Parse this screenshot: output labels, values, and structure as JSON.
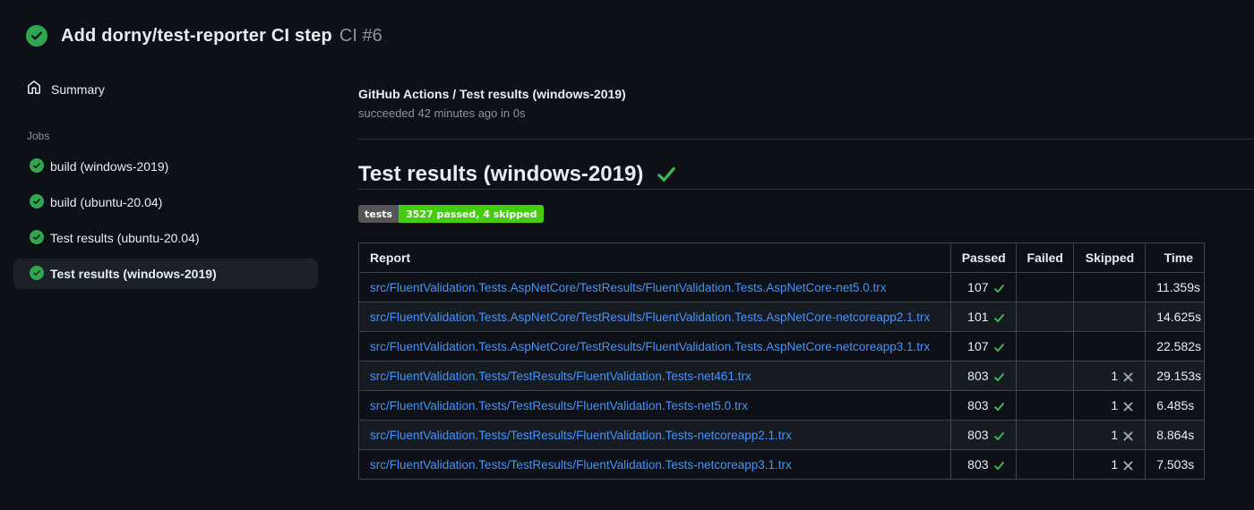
{
  "theme": {
    "page_bg": "#0d1117",
    "row_alt_bg": "#161b22",
    "selected_bg": "#1c2128",
    "border": "#3d444d",
    "link": "#4493f8",
    "success_green": "#3fb950",
    "circle_green": "#2ea84f",
    "muted_text": "#8b949e",
    "skip_gray": "#a0a8b0",
    "badge_label_bg": "#555555",
    "badge_value_bg": "#44cc11"
  },
  "header": {
    "title": "Add dorny/test-reporter CI step",
    "run_number": "CI #6",
    "status_icon": "check-circle-icon"
  },
  "sidebar": {
    "summary_label": "Summary",
    "jobs_label": "Jobs",
    "jobs": [
      {
        "label": "build (windows-2019)",
        "status": "success",
        "selected": false
      },
      {
        "label": "build (ubuntu-20.04)",
        "status": "success",
        "selected": false
      },
      {
        "label": "Test results (ubuntu-20.04)",
        "status": "success",
        "selected": false
      },
      {
        "label": "Test results (windows-2019)",
        "status": "success",
        "selected": true
      }
    ]
  },
  "main": {
    "check_title": "GitHub Actions / Test results (windows-2019)",
    "check_status": "succeeded 42 minutes ago in 0s",
    "section_title": "Test results (windows-2019)",
    "section_status_icon": "check-icon",
    "badge": {
      "label": "tests",
      "value": "3527 passed, 4 skipped"
    },
    "table": {
      "headers": [
        "Report",
        "Passed",
        "Failed",
        "Skipped",
        "Time"
      ],
      "rows": [
        {
          "report": "src/FluentValidation.Tests.AspNetCore/TestResults/FluentValidation.Tests.AspNetCore-net5.0.trx",
          "passed": "107",
          "failed": "",
          "skipped": "",
          "time": "11.359s"
        },
        {
          "report": "src/FluentValidation.Tests.AspNetCore/TestResults/FluentValidation.Tests.AspNetCore-netcoreapp2.1.trx",
          "passed": "101",
          "failed": "",
          "skipped": "",
          "time": "14.625s"
        },
        {
          "report": "src/FluentValidation.Tests.AspNetCore/TestResults/FluentValidation.Tests.AspNetCore-netcoreapp3.1.trx",
          "passed": "107",
          "failed": "",
          "skipped": "",
          "time": "22.582s"
        },
        {
          "report": "src/FluentValidation.Tests/TestResults/FluentValidation.Tests-net461.trx",
          "passed": "803",
          "failed": "",
          "skipped": "1",
          "time": "29.153s"
        },
        {
          "report": "src/FluentValidation.Tests/TestResults/FluentValidation.Tests-net5.0.trx",
          "passed": "803",
          "failed": "",
          "skipped": "1",
          "time": "6.485s"
        },
        {
          "report": "src/FluentValidation.Tests/TestResults/FluentValidation.Tests-netcoreapp2.1.trx",
          "passed": "803",
          "failed": "",
          "skipped": "1",
          "time": "8.864s"
        },
        {
          "report": "src/FluentValidation.Tests/TestResults/FluentValidation.Tests-netcoreapp3.1.trx",
          "passed": "803",
          "failed": "",
          "skipped": "1",
          "time": "7.503s"
        }
      ]
    }
  }
}
